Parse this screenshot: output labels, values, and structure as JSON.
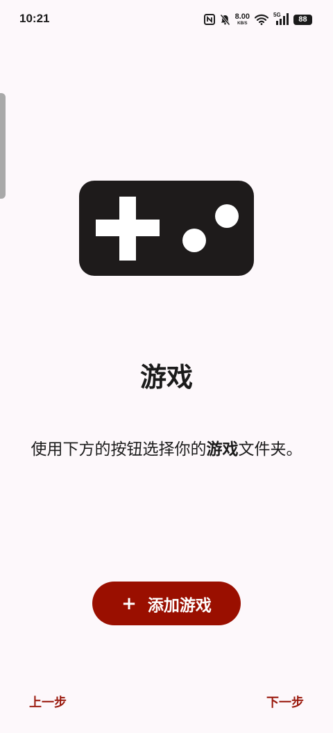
{
  "status_bar": {
    "time": "10:21",
    "net_speed_value": "8.00",
    "net_speed_unit": "KB/S",
    "signal_label": "5G",
    "battery": "88",
    "icons": [
      "nfc-icon",
      "bell-muted-icon",
      "wifi-icon",
      "cell-signal-icon",
      "battery-icon"
    ]
  },
  "main": {
    "illustration_icon": "gamepad-icon",
    "title": "游戏",
    "description_before": "使用下方的按钮选择你的",
    "description_bold": "游戏",
    "description_after": "文件夹。"
  },
  "add_button": {
    "icon": "plus-icon",
    "icon_glyph": "+",
    "label": "添加游戏",
    "color": "#9a0f00"
  },
  "nav": {
    "prev_label": "上一步",
    "next_label": "下一步",
    "color": "#9a1a0e"
  },
  "colors": {
    "background": "#fdf8fb",
    "illustration": "#1e1b1b"
  }
}
